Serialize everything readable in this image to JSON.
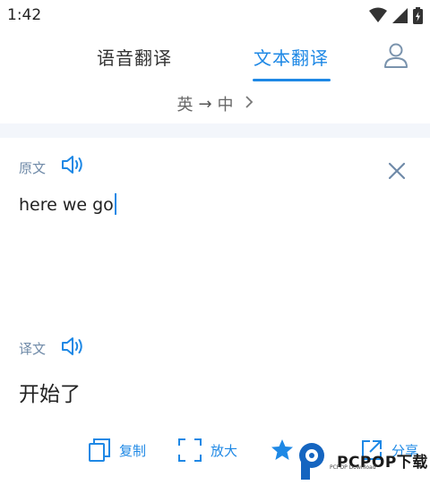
{
  "status": {
    "time": "1:42"
  },
  "tabs": [
    {
      "label": "语音翻译"
    },
    {
      "label": "文本翻译"
    }
  ],
  "lang": {
    "source": "英",
    "arrow": "→",
    "target": "中",
    "chevron": "›"
  },
  "source": {
    "label": "原文",
    "text": "here we go"
  },
  "target": {
    "label": "译文",
    "text": "开始了"
  },
  "actions": {
    "copy": "复制",
    "zoom": "放大",
    "share": "分享"
  },
  "watermark": {
    "text": "PCPOP下载",
    "sub": "PCPOP Download"
  },
  "colors": {
    "accent": "#1e88e5",
    "label": "#6f8aa8",
    "band": "#f3f6fb"
  }
}
